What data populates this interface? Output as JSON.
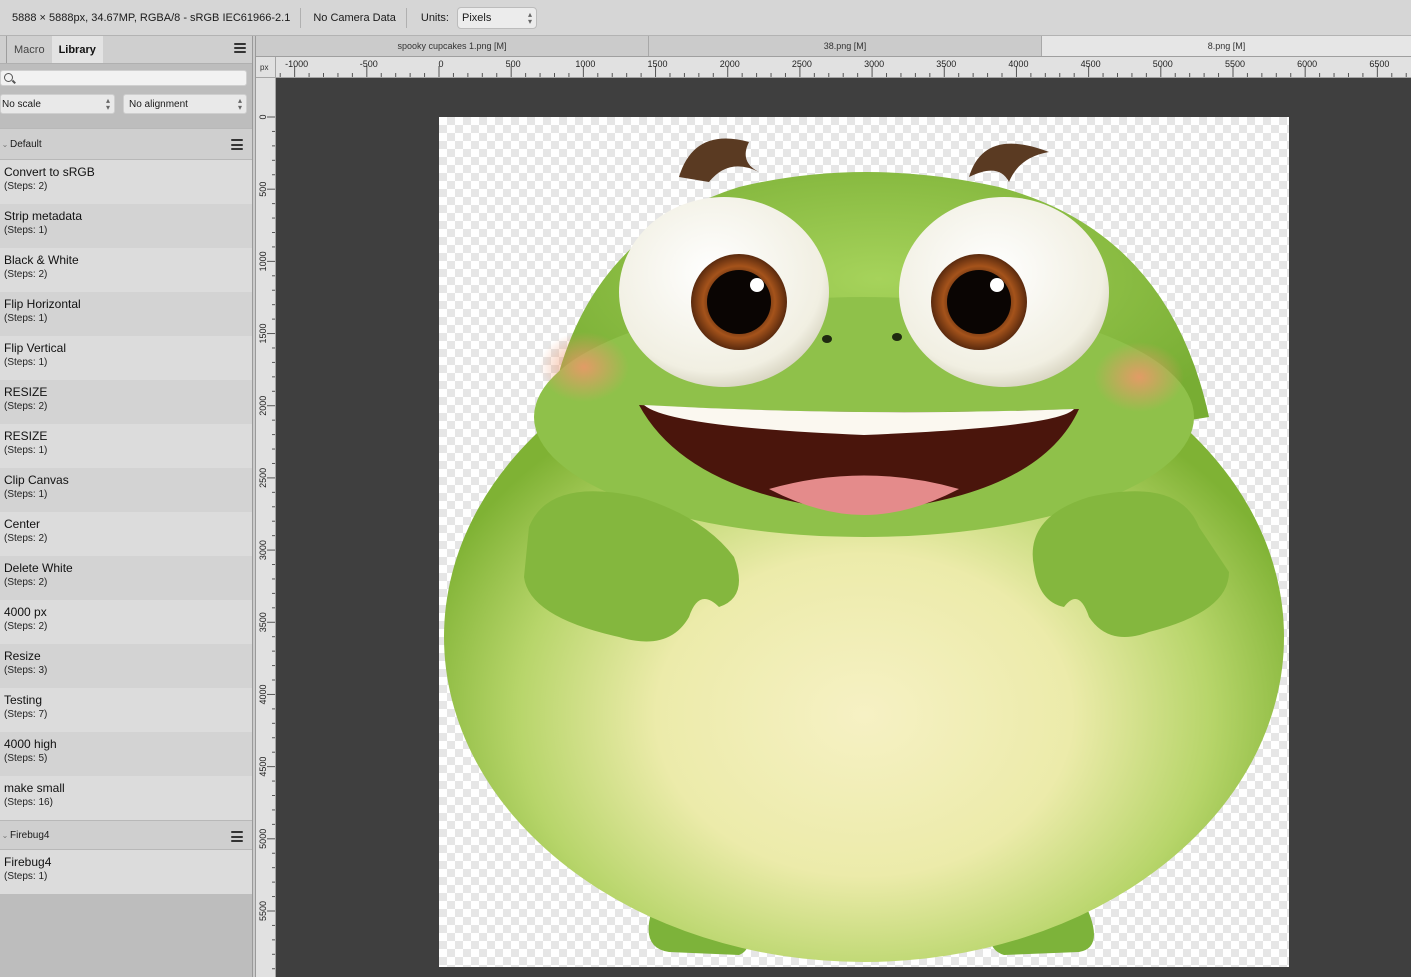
{
  "toolbar": {
    "doc_info": "5888 × 5888px, 34.67MP, RGBA/8 - sRGB IEC61966-2.1",
    "camera": "No Camera Data",
    "units_label": "Units:",
    "units_value": "Pixels"
  },
  "panel": {
    "tabs": [
      {
        "label": "Macro"
      },
      {
        "label": "Library",
        "active": true
      }
    ],
    "search_placeholder": "",
    "scale_value": "No scale",
    "alignment_value": "No alignment",
    "groups": [
      {
        "title": "Default",
        "macros": [
          {
            "name": "Convert to sRGB",
            "steps": "(Steps: 2)"
          },
          {
            "name": "Strip metadata",
            "steps": "(Steps: 1)"
          },
          {
            "name": "Black & White",
            "steps": "(Steps: 2)"
          },
          {
            "name": "Flip Horizontal",
            "steps": "(Steps: 1)"
          },
          {
            "name": "Flip Vertical",
            "steps": "(Steps: 1)"
          },
          {
            "name": "RESIZE",
            "steps": "(Steps: 2)"
          },
          {
            "name": "RESIZE",
            "steps": "(Steps: 1)"
          },
          {
            "name": "Clip Canvas",
            "steps": "(Steps: 1)"
          },
          {
            "name": "Center",
            "steps": "(Steps: 2)"
          },
          {
            "name": "Delete White",
            "steps": "(Steps: 2)"
          },
          {
            "name": "4000 px",
            "steps": "(Steps: 2)"
          },
          {
            "name": "Resize",
            "steps": "(Steps: 3)"
          },
          {
            "name": "Testing",
            "steps": "(Steps: 7)"
          },
          {
            "name": "4000 high",
            "steps": "(Steps: 5)"
          },
          {
            "name": "make small",
            "steps": "(Steps: 16)"
          }
        ]
      },
      {
        "title": "Firebug4",
        "macros": [
          {
            "name": "Firebug4",
            "steps": "(Steps: 1)"
          }
        ]
      }
    ]
  },
  "documents": [
    {
      "label": "spooky cupcakes 1.png [M]"
    },
    {
      "label": "38.png [M]"
    },
    {
      "label": "8.png [M]",
      "active": true
    }
  ],
  "ruler": {
    "unit": "px",
    "x_labels": [
      "-1000",
      "-500",
      "0",
      "500",
      "1000",
      "1500",
      "2000",
      "2500",
      "3000",
      "3500",
      "4000",
      "4500",
      "5000",
      "5500",
      "6000",
      "6500"
    ],
    "y_labels": [
      "0",
      "500",
      "1000",
      "1500",
      "2000",
      "2500",
      "3000",
      "3500",
      "4000",
      "4500",
      "5000",
      "5500"
    ]
  },
  "canvas": {
    "image_subject": "green-frog-character",
    "background": "#3f3f3f"
  }
}
